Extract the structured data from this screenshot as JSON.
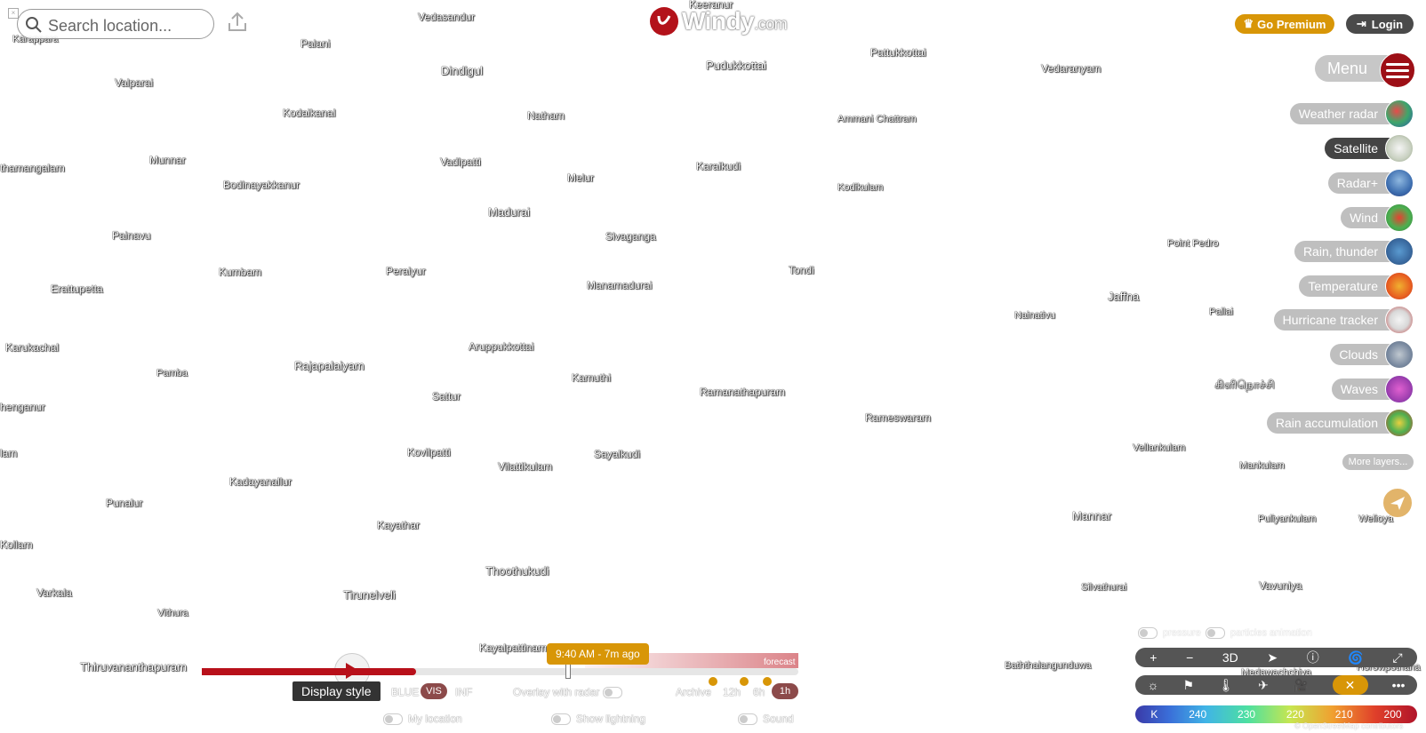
{
  "search": {
    "placeholder": "Search location..."
  },
  "logo": {
    "name": "Windy",
    "suffix": ".com"
  },
  "header": {
    "premium_label": "Go Premium",
    "login_label": "Login",
    "menu_label": "Menu"
  },
  "layers": [
    {
      "label": "Weather radar",
      "active": false
    },
    {
      "label": "Satellite",
      "active": true
    },
    {
      "label": "Radar+",
      "active": false
    },
    {
      "label": "Wind",
      "active": false
    },
    {
      "label": "Rain, thunder",
      "active": false
    },
    {
      "label": "Temperature",
      "active": false
    },
    {
      "label": "Hurricane tracker",
      "active": false
    },
    {
      "label": "Clouds",
      "active": false
    },
    {
      "label": "Waves",
      "active": false
    },
    {
      "label": "Rain accumulation",
      "active": false
    }
  ],
  "more_layers_label": "More layers...",
  "timeline": {
    "time_label": "9:40 AM - 7m ago",
    "forecast_label": "forecast",
    "display_style_label": "Display style",
    "bands": [
      "BLUE",
      "VIS",
      "INF"
    ],
    "overlay_radar_label": "Overlay with radar",
    "archive_label": "Archive",
    "intervals": [
      "12h",
      "6h",
      "1h"
    ],
    "my_location_label": "My location",
    "show_lightning_label": "Show lightning",
    "sound_label": "Sound"
  },
  "overlays": {
    "pressure_label": "pressure",
    "particles_label": "particles animation"
  },
  "toolbar": {
    "three_d_label": "3D"
  },
  "legend": {
    "unit": "K",
    "values": [
      "240",
      "230",
      "220",
      "210",
      "200"
    ]
  },
  "attribution": "© OpenStreetMap contributors",
  "cities": [
    {
      "name": "Keeranur"
    },
    {
      "name": "Vedasandur"
    },
    {
      "name": "Karappara"
    },
    {
      "name": "Palani"
    },
    {
      "name": "Dindigul"
    },
    {
      "name": "Pudukkottai"
    },
    {
      "name": "Pattukkottai"
    },
    {
      "name": "Vedaranyam"
    },
    {
      "name": "Valparai"
    },
    {
      "name": "Kodaikanal"
    },
    {
      "name": "Natham"
    },
    {
      "name": "Ammani Chattram"
    },
    {
      "name": "thamangalam"
    },
    {
      "name": "Munnar"
    },
    {
      "name": "Vadipatti"
    },
    {
      "name": "Karaikudi"
    },
    {
      "name": "Bodinayakkanur"
    },
    {
      "name": "Melur"
    },
    {
      "name": "Kodikulam"
    },
    {
      "name": "Madurai"
    },
    {
      "name": "Painavu"
    },
    {
      "name": "Sivaganga"
    },
    {
      "name": "Point Pedro"
    },
    {
      "name": "Kumbam"
    },
    {
      "name": "Peraiyur"
    },
    {
      "name": "Tondi"
    },
    {
      "name": "Erattupetta"
    },
    {
      "name": "Manamadurai"
    },
    {
      "name": "Jaffna"
    },
    {
      "name": "Nainativu"
    },
    {
      "name": "Pallai"
    },
    {
      "name": "Karukachal"
    },
    {
      "name": "Aruppukkottai"
    },
    {
      "name": "Pamba"
    },
    {
      "name": "Rajapalaiyam"
    },
    {
      "name": "Kamuthi"
    },
    {
      "name": "Ramanathapuram"
    },
    {
      "name": "கிளிநொச்சி"
    },
    {
      "name": "henganur"
    },
    {
      "name": "Sattur"
    },
    {
      "name": "Rameswaram"
    },
    {
      "name": "Vellankulam"
    },
    {
      "name": "lam"
    },
    {
      "name": "Kovilpatti"
    },
    {
      "name": "Vilattikulam"
    },
    {
      "name": "Sayalkudi"
    },
    {
      "name": "Mankulam"
    },
    {
      "name": "Kadayanallur"
    },
    {
      "name": "Punalur"
    },
    {
      "name": "Mannar"
    },
    {
      "name": "Puliyankulam"
    },
    {
      "name": "Welioya"
    },
    {
      "name": "Kayathar"
    },
    {
      "name": "Kollam"
    },
    {
      "name": "Thoothukudi"
    },
    {
      "name": "Varkala"
    },
    {
      "name": "Tirunelveli"
    },
    {
      "name": "Silvathurai"
    },
    {
      "name": "Vavuniya"
    },
    {
      "name": "Vithura"
    },
    {
      "name": "Kayalpattinam"
    },
    {
      "name": "Thiruvananthapuram"
    },
    {
      "name": "Baththalangunduwa"
    },
    {
      "name": "Medawachchiya"
    },
    {
      "name": "Horowpothana"
    }
  ]
}
